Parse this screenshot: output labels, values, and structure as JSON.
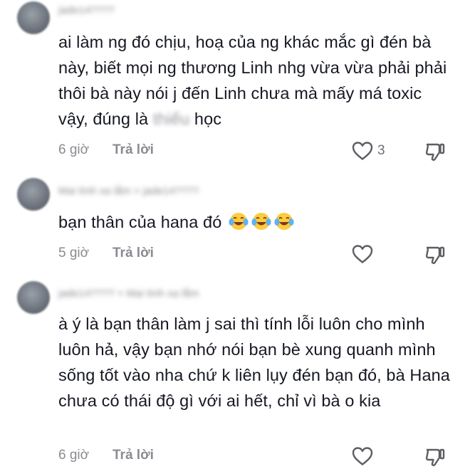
{
  "comments": [
    {
      "username": "jade14????",
      "parts": [
        "ai làm ng đó chịu, hoạ của ng khác mắc gì đén bà này, biết mọi ng thương Linh nhg vừa vừa phải phải thôi bà này nói j đến Linh chưa mà mấy má toxic vậy, đúng là ",
        "thiếu",
        " học"
      ],
      "time": "6 giờ",
      "reply_label": "Trả lời",
      "like_count": "3"
    },
    {
      "username": "Mai tình xa lắm > jade14????",
      "text": "bạn thân của hana đó",
      "emojis": [
        "face-with-tears-of-joy",
        "face-with-tears-of-joy",
        "face-with-tears-of-joy"
      ],
      "time": "5 giờ",
      "reply_label": "Trả lời",
      "like_count": ""
    },
    {
      "username": "jade14???? > Mai tình xa lắm",
      "text": "à ý là bạn thân làm j sai thì tính lỗi luôn cho mình luôn hả, vậy bạn nhớ nói bạn bè xung quanh mình sống tốt vào nha chứ k liên lụy đén bạn đó, bà Hana chưa có thái độ gì với ai hết, chỉ vì bà o kia",
      "time": "6 giờ",
      "reply_label": "Trả lời",
      "like_count": ""
    }
  ],
  "icons": {
    "like": "heart-outline-icon",
    "dislike": "thumbs-down-outline-icon",
    "emoji": "face-with-tears-of-joy"
  },
  "colors": {
    "text": "#161823",
    "meta": "#8a8b91",
    "emoji_yellow": "#FFCB3D"
  }
}
